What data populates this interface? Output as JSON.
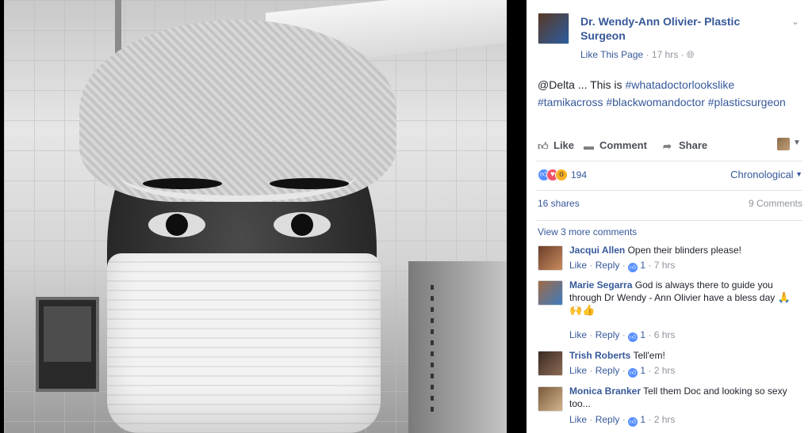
{
  "post": {
    "page_name": "Dr. Wendy-Ann Olivier- Plastic Surgeon",
    "like_page": "Like This Page",
    "time": "17 hrs",
    "audience_icon": "globe-icon",
    "text_prefix": "@Delta ... This is ",
    "hashtags": [
      "#whatadoctorlookslike",
      "#tamikacross",
      "#blackwomandoctor",
      "#plasticsurgeon"
    ]
  },
  "actions": {
    "like": "Like",
    "comment": "Comment",
    "share": "Share"
  },
  "reactions": {
    "count": "194",
    "sort": "Chronological"
  },
  "stats": {
    "shares": "16 shares",
    "comments": "9 Comments"
  },
  "view_more": "View 3 more comments",
  "comments": [
    {
      "author": "Jacqui Allen",
      "text": "Open their blinders please!",
      "like": "Like",
      "reply": "Reply",
      "likes": "1",
      "time": "7 hrs"
    },
    {
      "author": "Marie Segarra",
      "text": "God is always there to guide you through Dr Wendy - Ann Olivier have a bless day",
      "like": "Like",
      "reply": "Reply",
      "likes": "1",
      "time": "6 hrs",
      "emojis": [
        "🙏",
        "🙌",
        "👍"
      ]
    },
    {
      "author": "Trish Roberts",
      "text": "Tell'em!",
      "like": "Like",
      "reply": "Reply",
      "likes": "1",
      "time": "2 hrs"
    },
    {
      "author": "Monica Branker",
      "text": "Tell them Doc and looking so sexy too...",
      "like": "Like",
      "reply": "Reply",
      "likes": "1",
      "time": "2 hrs"
    }
  ],
  "colors": {
    "link": "#365899",
    "muted": "#90949c",
    "like_blue": "#5890ff"
  }
}
